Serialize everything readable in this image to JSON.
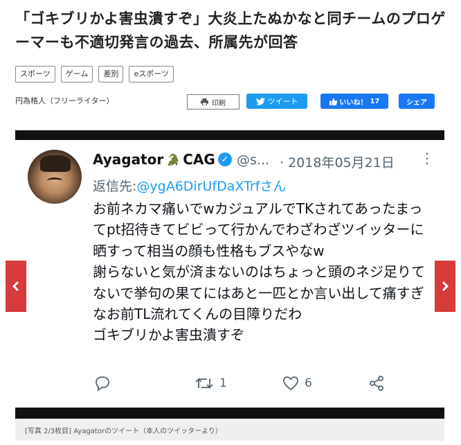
{
  "article": {
    "headline": "「ゴキブリかよ害虫潰すぞ」大炎上たぬかなと同チームのプロゲーマーも不適切発言の過去、所属先が回答",
    "tags": [
      "スポーツ",
      "ゲーム",
      "差別",
      "eスポーツ"
    ],
    "author": "円為格人（フリーライター）"
  },
  "share": {
    "print_label": "印刷",
    "tweet_label": "ツイート",
    "like_label": "いいね！",
    "like_count": "17",
    "share_label": "シェア"
  },
  "tweet": {
    "display_name": "Ayagator",
    "name_suffix": "CAG",
    "handle_truncated": "@s...",
    "separator": "·",
    "date": "2018年05月21日",
    "reply_prefix": "返信先:",
    "reply_to": "@ygA6DirUfDaXTrf",
    "reply_suffix": "さん",
    "body": "お前ネカマ痛いでwカジュアルでTKされてあったまってpt招待きてビビって行かんでわざわざツイッターに晒すって相当の顔も性格もブスやなw\n謝らないと気が済まないのはちょっと頭のネジ足りてないで挙句の果てにはあと一匹とか言い出して痛すぎなお前TL流れてくんの目障りだわ\nゴキブリかよ害虫潰すぞ",
    "retweet_count": "1",
    "like_count": "6"
  },
  "caption": "[写真 2/3枚目] Ayagatorのツイート（本人のツイッターより）",
  "colors": {
    "twitter_blue": "#1d9bf0",
    "facebook_blue": "#1877f2",
    "nav_red": "#d63b3b"
  }
}
